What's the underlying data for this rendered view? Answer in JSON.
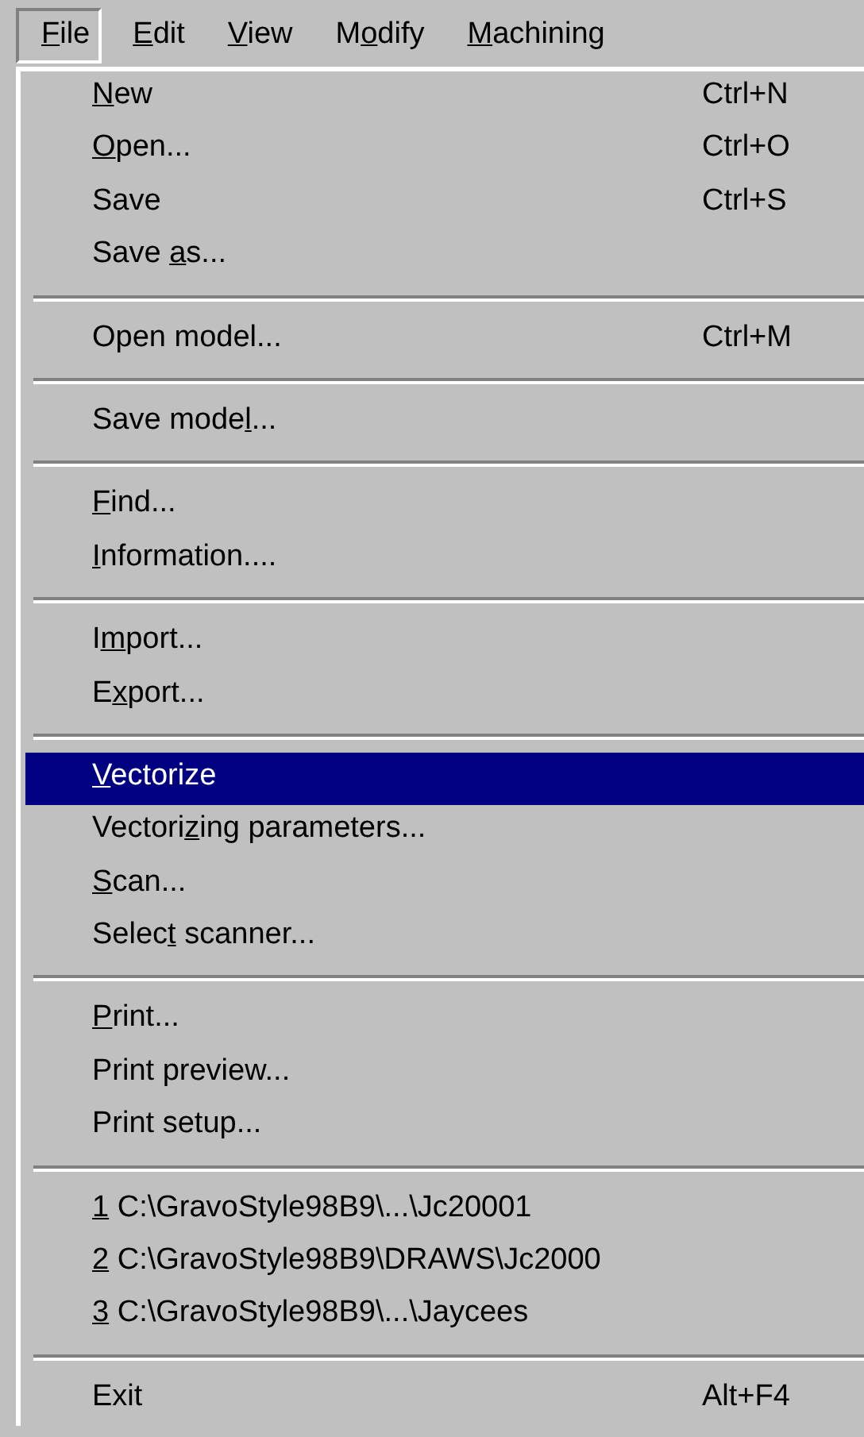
{
  "menubar": [
    {
      "key": "F",
      "post": "ile",
      "selected": true
    },
    {
      "key": "E",
      "post": "dit",
      "selected": false
    },
    {
      "key": "V",
      "post": "iew",
      "selected": false
    },
    {
      "pre": "M",
      "key": "o",
      "post": "dify",
      "selected": false
    },
    {
      "key": "M",
      "post": "achining",
      "selected": false
    }
  ],
  "menu": {
    "groups": [
      {
        "items": [
          {
            "key": "N",
            "post": "ew",
            "shortcut": "Ctrl+N",
            "selected": false
          },
          {
            "key": "O",
            "post": "pen...",
            "shortcut": "Ctrl+O",
            "selected": false
          },
          {
            "pre": "Save",
            "shortcut": "Ctrl+S",
            "selected": false
          },
          {
            "pre": "Save ",
            "key": "a",
            "post": "s...",
            "selected": false
          }
        ]
      },
      {
        "items": [
          {
            "pre": "Open model...",
            "shortcut": "Ctrl+M",
            "selected": false
          }
        ]
      },
      {
        "items": [
          {
            "pre": "Save mode",
            "key": "l",
            "post": "...",
            "selected": false
          }
        ]
      },
      {
        "items": [
          {
            "key": "F",
            "post": "ind...",
            "selected": false
          },
          {
            "key": "I",
            "post": "nformation....",
            "selected": false
          }
        ]
      },
      {
        "items": [
          {
            "pre": "I",
            "key": "m",
            "post": "port...",
            "selected": false
          },
          {
            "pre": "E",
            "key": "x",
            "post": "port...",
            "selected": false
          }
        ]
      },
      {
        "items": [
          {
            "key": "V",
            "post": "ectorize",
            "selected": true
          },
          {
            "pre": "Vectori",
            "key": "z",
            "post": "ing parameters...",
            "selected": false
          },
          {
            "key": "S",
            "post": "can...",
            "selected": false
          },
          {
            "pre": "Selec",
            "key": "t",
            "post": " scanner...",
            "selected": false
          }
        ]
      },
      {
        "items": [
          {
            "key": "P",
            "post": "rint...",
            "selected": false
          },
          {
            "pre": "Print preview...",
            "selected": false
          },
          {
            "pre": "Print setup...",
            "selected": false
          }
        ]
      },
      {
        "items": [
          {
            "key": "1",
            "post": " C:\\GravoStyle98B9\\...\\Jc20001",
            "selected": false
          },
          {
            "key": "2",
            "post": " C:\\GravoStyle98B9\\DRAWS\\Jc2000",
            "selected": false
          },
          {
            "key": "3",
            "post": " C:\\GravoStyle98B9\\...\\Jaycees",
            "selected": false
          }
        ]
      },
      {
        "items": [
          {
            "pre": "Exit",
            "shortcut": "Alt+F4",
            "selected": false
          }
        ]
      }
    ]
  }
}
